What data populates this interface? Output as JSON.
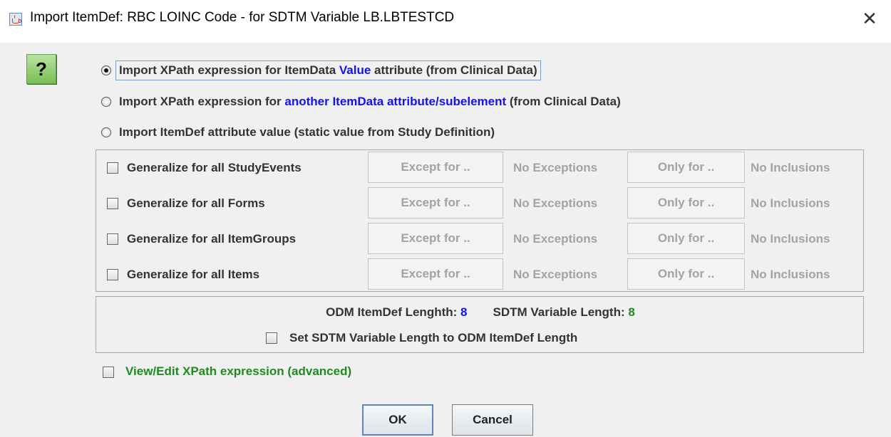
{
  "window": {
    "title": "Import ItemDef: RBC LOINC Code - for SDTM Variable LB.LBTESTCD",
    "close_glyph": "✕"
  },
  "help_button": {
    "label": "?",
    "icon": "help-icon"
  },
  "options": {
    "opt1": {
      "prefix": "Import XPath expression for ItemData ",
      "highlight": "Value",
      "suffix": " attribute (from Clinical Data)",
      "selected": true
    },
    "opt2": {
      "prefix": "Import XPath expression for ",
      "highlight": "another ItemData attribute/subelement",
      "suffix": " (from Clinical Data)",
      "selected": false
    },
    "opt3": {
      "label": "Import ItemDef attribute value (static value from Study Definition)",
      "selected": false
    }
  },
  "generalize": {
    "rows": [
      {
        "label": "Generalize for all StudyEvents",
        "except": "Except for ..",
        "no_exceptions": "No Exceptions",
        "only": "Only for ..",
        "no_inclusions": "No Inclusions"
      },
      {
        "label": "Generalize for all Forms",
        "except": "Except for ..",
        "no_exceptions": "No Exceptions",
        "only": "Only for ..",
        "no_inclusions": "No Inclusions"
      },
      {
        "label": "Generalize for all ItemGroups",
        "except": "Except for ..",
        "no_exceptions": "No Exceptions",
        "only": "Only for ..",
        "no_inclusions": "No Inclusions"
      },
      {
        "label": "Generalize for all Items",
        "except": "Except for ..",
        "no_exceptions": "No Exceptions",
        "only": "Only for ..",
        "no_inclusions": "No Inclusions"
      }
    ]
  },
  "length": {
    "odm_label": "ODM ItemDef Lenghth:",
    "odm_value": "8",
    "sdtm_label": "SDTM Variable Length:",
    "sdtm_value": "8",
    "set_label": "Set SDTM Variable Length to ODM ItemDef Length"
  },
  "advanced": {
    "label": "View/Edit XPath expression (advanced)"
  },
  "buttons": {
    "ok": "OK",
    "cancel": "Cancel"
  },
  "colors": {
    "highlight_blue": "#1010ff",
    "value_green": "#1f8a1f",
    "help_green": "#78bf55"
  }
}
